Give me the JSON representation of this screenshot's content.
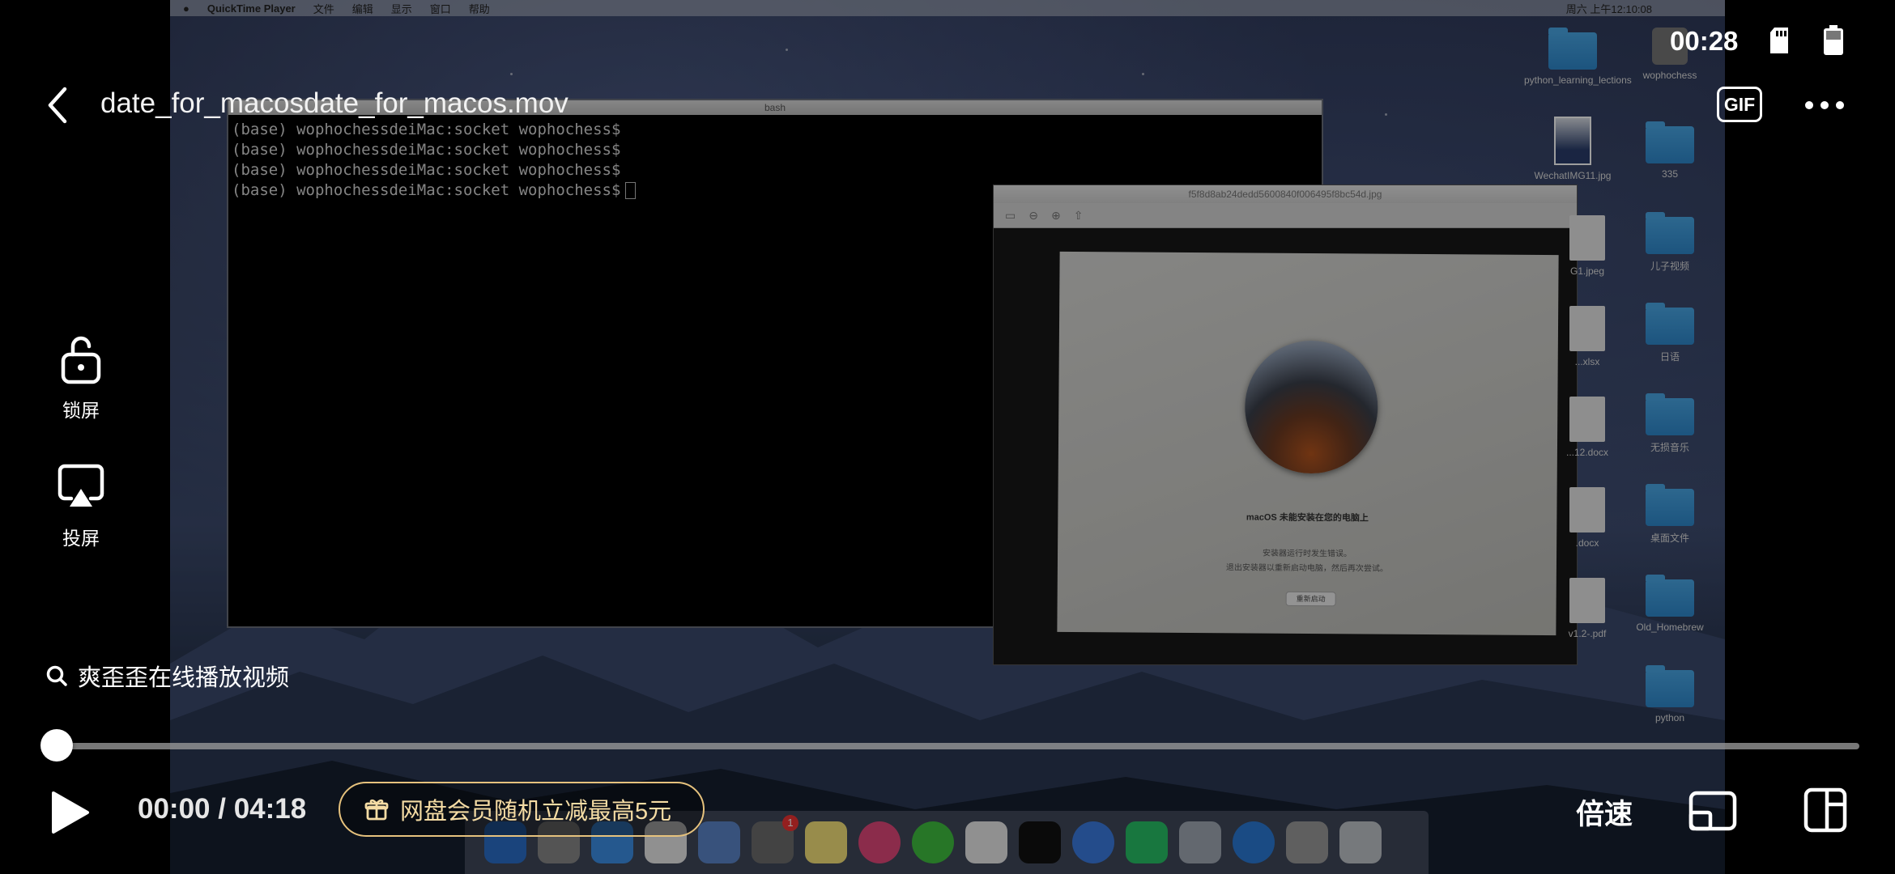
{
  "player": {
    "title": "date_for_macosdate_for_macos.mov",
    "clock": "00:28",
    "gif_label": "GIF",
    "lock_label": "锁屏",
    "cast_label": "投屏",
    "search_hint": "爽歪歪在线播放视频",
    "time": "00:00 / 04:18",
    "progress": 0.0,
    "promo": "网盘会员随机立减最高5元",
    "speed_label": "倍速"
  },
  "mac": {
    "menubar": {
      "app": "QuickTime Player",
      "items": [
        "文件",
        "编辑",
        "显示",
        "窗口",
        "帮助"
      ],
      "datetime": "周六 上午12:10:08"
    },
    "terminal": {
      "title": "bash",
      "lines": [
        "(base) wophochessdeiMac:socket wophochess$",
        "(base) wophochessdeiMac:socket wophochess$",
        "(base) wophochessdeiMac:socket wophochess$",
        "(base) wophochessdeiMac:socket wophochess$"
      ]
    },
    "preview": {
      "title": "f5f8d8ab24dedd5600840f006495f8bc54d.jpg",
      "msg_title": "macOS 未能安装在您的电脑上",
      "msg_line1": "安装器运行时发生错误。",
      "msg_line2": "退出安装器以重新启动电脑，然后再次尝试。",
      "button": "重新启动"
    },
    "desktop_icons": [
      {
        "label": "python_learning_lections",
        "kind": "folder"
      },
      {
        "label": "wophochess",
        "kind": "disk"
      },
      {
        "label": "WechatIMG11.jpg",
        "kind": "photo"
      },
      {
        "label": "335",
        "kind": "folder"
      },
      {
        "label": "G1.jpeg",
        "kind": "file"
      },
      {
        "label": "儿子视频",
        "kind": "folder"
      },
      {
        "label": "...xlsx",
        "kind": "file"
      },
      {
        "label": "日语",
        "kind": "folder"
      },
      {
        "label": "...12.docx",
        "kind": "file"
      },
      {
        "label": "无损音乐",
        "kind": "folder"
      },
      {
        "label": ".docx",
        "kind": "file"
      },
      {
        "label": "桌面文件",
        "kind": "folder"
      },
      {
        "label": "v1.2-.pdf",
        "kind": "file"
      },
      {
        "label": "Old_Homebrew",
        "kind": "folder"
      },
      {
        "label": "python",
        "kind": "folder"
      }
    ],
    "dock_badge": "1"
  }
}
